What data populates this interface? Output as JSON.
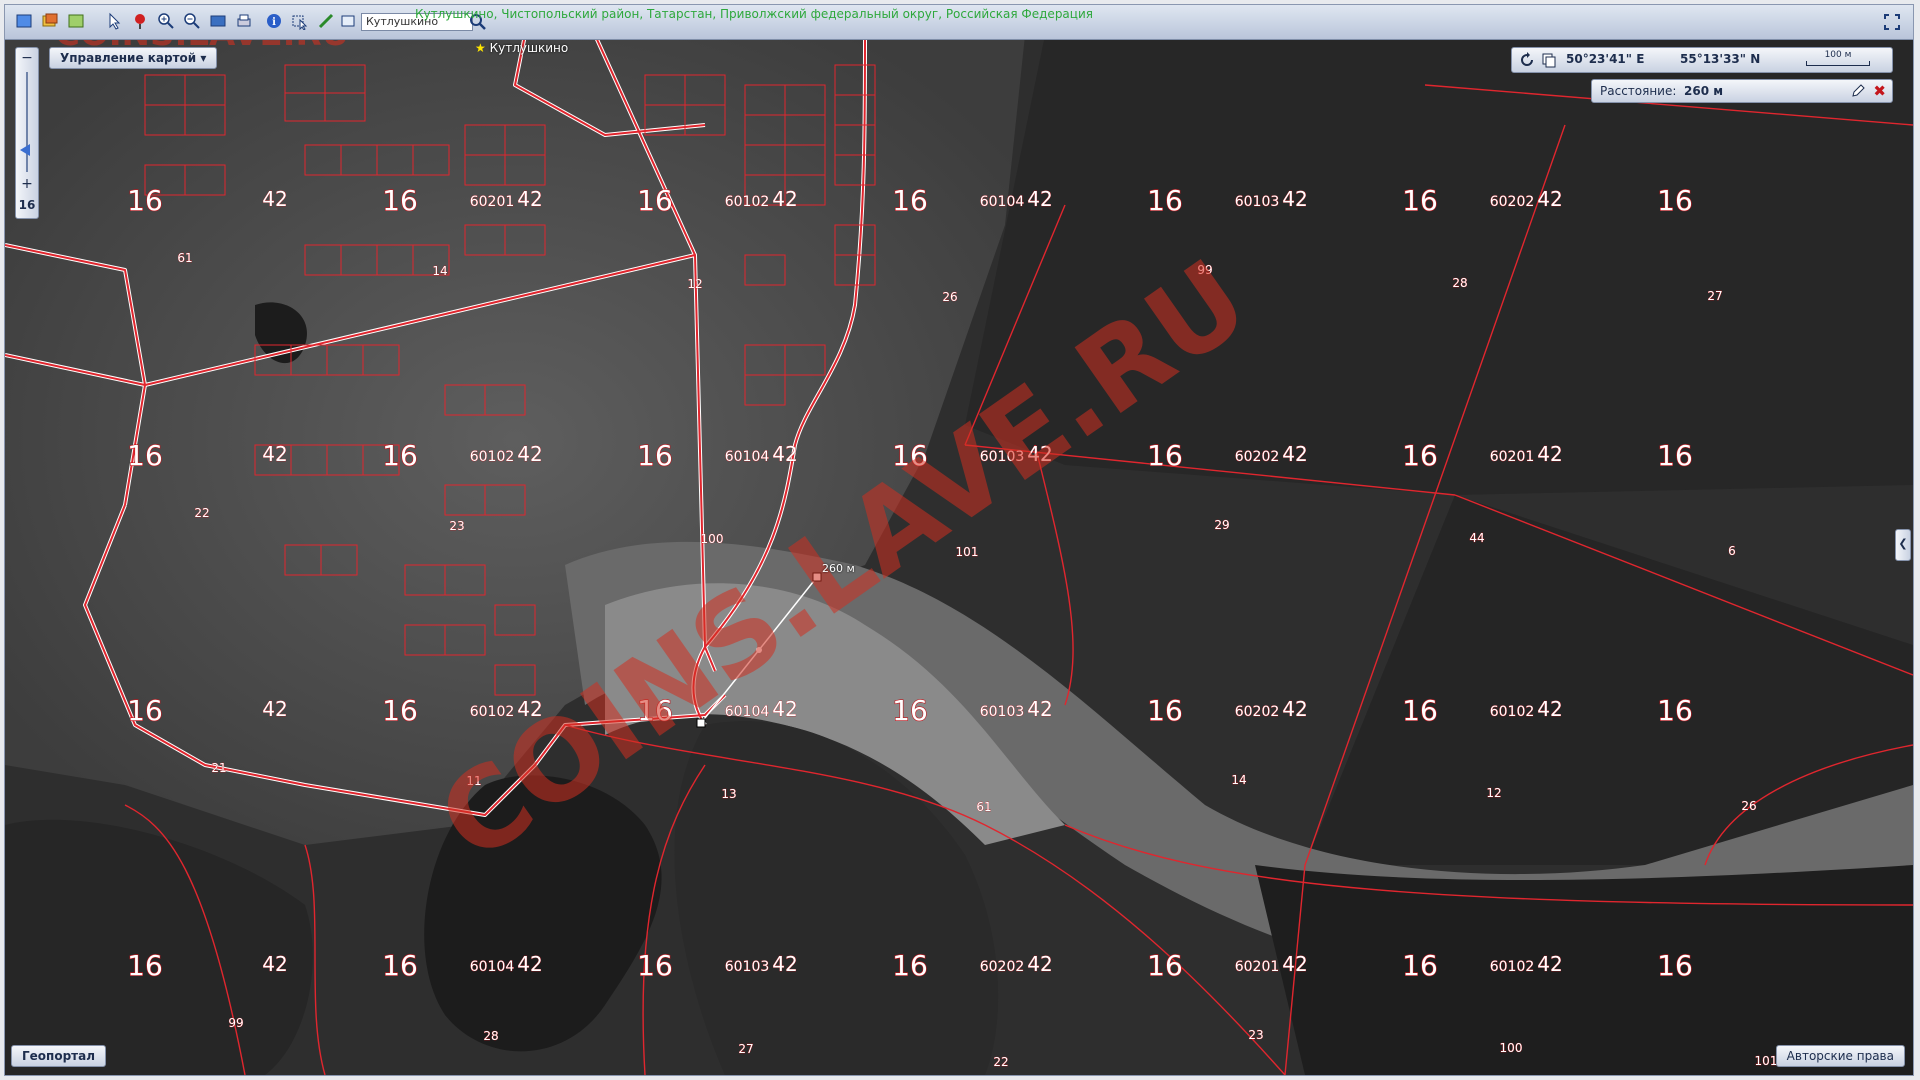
{
  "toolbar": {
    "search_value": "Кутлушкино",
    "breadcrumb": "Кутлушкино, Чистопольский район, Татарстан, Приволжский федеральный округ, Российская Федерация"
  },
  "map_control": {
    "label": "Управление картой ▾"
  },
  "zoom": {
    "plus": "+",
    "minus": "−",
    "level": "16"
  },
  "place_marker": {
    "star": "★",
    "name": "Кутлушкино"
  },
  "coords": {
    "lon": "50°23'41\" E",
    "lat": "55°13'33\" N",
    "scale": "100 м"
  },
  "distance": {
    "label": "Расстояние:",
    "value": "260 м",
    "close": "✖"
  },
  "measurement": {
    "label": "260 м"
  },
  "bottom": {
    "geoportal": "Геопортал",
    "rights": "Авторские права"
  },
  "side_toggle": "❮",
  "watermark": "COINS.LAVE.RU",
  "map_labels": {
    "zone_16": "16",
    "zone_42": "42",
    "parcels": [
      "60201",
      "60102",
      "60104",
      "60103",
      "60202",
      "60102",
      "60104",
      "60103",
      "60202"
    ],
    "numbers": [
      "61",
      "14",
      "12",
      "26",
      "99",
      "28",
      "27",
      "22",
      "23",
      "100",
      "101",
      "29",
      "44",
      "6",
      "21",
      "11",
      "13"
    ]
  },
  "colors": {
    "boundary": "#e0262e",
    "accent": "#1d2d4d",
    "coord_green": "#2ea83c"
  }
}
